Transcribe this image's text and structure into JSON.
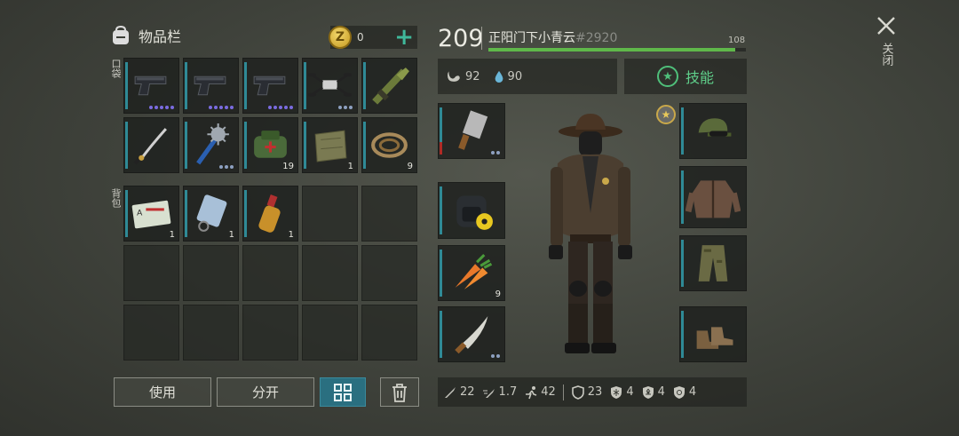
{
  "inventory": {
    "title": "物品栏",
    "coins": "0",
    "pocket_label": "口袋",
    "backpack_label": "背包",
    "pocket_items": [
      {
        "icon": "pistol-icon",
        "dots": [
          "p",
          "p",
          "p",
          "p",
          "p"
        ]
      },
      {
        "icon": "pistol-icon",
        "dots": [
          "p",
          "p",
          "p",
          "p",
          "p"
        ]
      },
      {
        "icon": "pistol-icon",
        "dots": [
          "p",
          "p",
          "p",
          "p",
          "p"
        ]
      },
      {
        "icon": "drone-icon",
        "dots": [
          "g",
          "g",
          "g"
        ]
      },
      {
        "icon": "rocket-launcher-icon",
        "dots": []
      },
      {
        "icon": "katana-icon",
        "dots": []
      },
      {
        "icon": "mace-icon",
        "dots": [
          "g",
          "g",
          "g"
        ]
      },
      {
        "icon": "medkit-bag-icon",
        "count": "19"
      },
      {
        "icon": "cloth-icon",
        "count": "1"
      },
      {
        "icon": "rope-icon",
        "count": "9"
      }
    ],
    "backpack_items": [
      {
        "icon": "id-card-icon",
        "count": "1"
      },
      {
        "icon": "tag-icon",
        "count": "1"
      },
      {
        "icon": "bottle-icon",
        "count": "1"
      }
    ],
    "use_label": "使用",
    "split_label": "分开"
  },
  "player": {
    "level": "209",
    "name": "正阳门下小青云",
    "tag": "#2920",
    "xp_value": "108",
    "xp_fraction": 0.96,
    "hunger": "92",
    "thirst": "90",
    "skills_label": "技能"
  },
  "close_label": "关闭",
  "equipment": {
    "left": [
      {
        "icon": "cleaver-icon",
        "dots": [
          "g",
          "g"
        ]
      },
      {
        "icon": "backpack-icon"
      },
      {
        "icon": "carrot-icon",
        "count": "9"
      },
      {
        "icon": "machete-icon",
        "dots": [
          "g",
          "g"
        ]
      }
    ],
    "right": [
      {
        "icon": "cap-icon"
      },
      {
        "icon": "jacket-icon"
      },
      {
        "icon": "pants-icon"
      },
      {
        "icon": "boots-icon"
      }
    ]
  },
  "stats": [
    {
      "icon": "sword-icon",
      "value": "22"
    },
    {
      "icon": "speed-sword-icon",
      "value": "1.7"
    },
    {
      "icon": "run-icon",
      "value": "42"
    },
    {
      "icon": "shield-icon",
      "value": "23"
    },
    {
      "icon": "cold-shield-icon",
      "value": "4"
    },
    {
      "icon": "radiation-shield-icon",
      "value": "4"
    },
    {
      "icon": "bio-shield-icon",
      "value": "4"
    }
  ]
}
